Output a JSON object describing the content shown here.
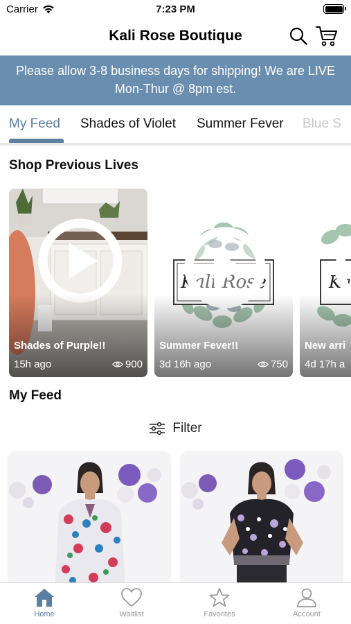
{
  "status_bar": {
    "carrier": "Carrier",
    "time": "7:23 PM"
  },
  "header": {
    "title": "Kali Rose Boutique",
    "search_icon": "search-icon",
    "cart_icon": "cart-icon"
  },
  "banner": {
    "line1": "Please allow 3-8 business days for shipping! We are LIVE",
    "line2": "Mon-Thur @ 8pm est."
  },
  "tabs": [
    {
      "label": "My Feed",
      "active": true
    },
    {
      "label": "Shades of Violet"
    },
    {
      "label": "Summer Fever"
    },
    {
      "label": "Blue S"
    }
  ],
  "previous_lives": {
    "heading": "Shop Previous Lives",
    "items": [
      {
        "title": "Shades of Purple!!",
        "ago": "15h ago",
        "views": "900"
      },
      {
        "title": "Summer Fever!!",
        "ago": "3d 16h ago",
        "views": "750"
      },
      {
        "title": "New arri",
        "ago": "4d 17h a",
        "views": ""
      }
    ]
  },
  "feed": {
    "heading": "My Feed",
    "filter_label": "Filter"
  },
  "tab_bar": [
    {
      "label": "Home",
      "icon": "home-icon",
      "active": true
    },
    {
      "label": "Waitlist",
      "icon": "heart-icon"
    },
    {
      "label": "Favorites",
      "icon": "star-icon"
    },
    {
      "label": "Account",
      "icon": "person-icon"
    }
  ],
  "colors": {
    "accent": "#5d7f9f",
    "banner": "#6a8eaf"
  }
}
